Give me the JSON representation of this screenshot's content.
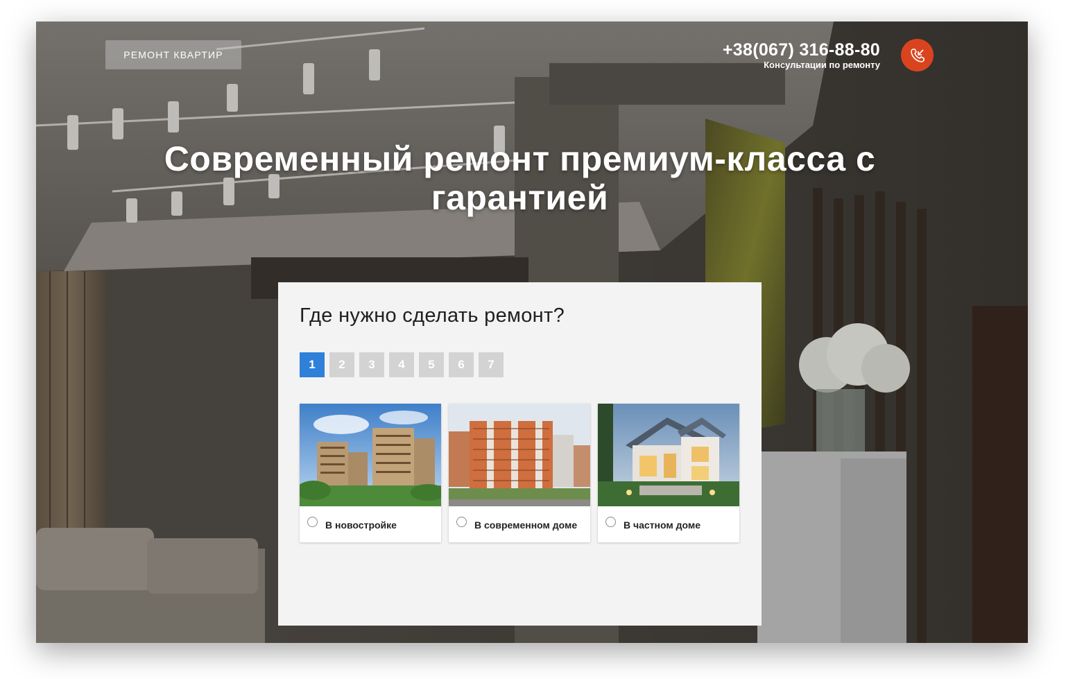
{
  "header": {
    "logo_label": "РЕМОНТ КВАРТИР",
    "phone": "+38(067) 316-88-80",
    "phone_caption": "Консультации по ремонту",
    "call_icon": "phone-call-icon"
  },
  "hero": {
    "title": "Современный ремонт премиум-класса с гарантией"
  },
  "quiz": {
    "question": "Где нужно сделать ремонт?",
    "steps": [
      "1",
      "2",
      "3",
      "4",
      "5",
      "6",
      "7"
    ],
    "current_step": "1",
    "options": [
      {
        "label": "В новостройке"
      },
      {
        "label": "В современном доме"
      },
      {
        "label": "В частном доме"
      }
    ]
  },
  "colors": {
    "accent_blue": "#2f80d9",
    "call_button": "#d9441f",
    "step_inactive": "#d3d3d3",
    "panel_bg": "#f3f3f3"
  }
}
